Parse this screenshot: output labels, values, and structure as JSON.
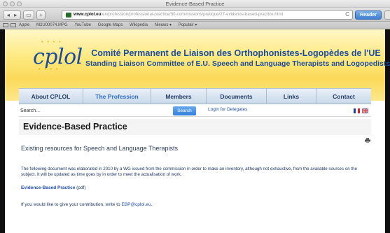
{
  "browser": {
    "window_title": "Evidence-Based Practice",
    "url_host": "www.cplol.eu",
    "url_path": "/en/profession/professional-practice/30-commissions/pratique/27-evidence-based-practice.html",
    "reader_label": "Reader",
    "reload_glyph": "C",
    "bookmarks": [
      "Apple",
      "M2U00074.MPG",
      "YouTube",
      "Google Maps",
      "Wikipedia",
      "Nieuws ▾",
      "Populair ▾"
    ]
  },
  "header": {
    "logo_text": "cplol",
    "org_name_fr": "Comité Permanent de Liaison des Orthophonistes-Logopèdes de l'UE",
    "org_name_en": "Standing Liaison Committee of E.U. Speech and Language Therapists and Logopedists"
  },
  "nav": {
    "items": [
      {
        "label": "About CPLOL"
      },
      {
        "label": "The Profession"
      },
      {
        "label": "Members"
      },
      {
        "label": "Documents"
      },
      {
        "label": "Links"
      },
      {
        "label": "Contact"
      }
    ]
  },
  "search": {
    "placeholder": "Search...",
    "button_label": "Search",
    "login_label": "Login for Delegates"
  },
  "article": {
    "title": "Evidence-Based Practice",
    "subtitle": "Existing resources for Speech and Language Therapists",
    "paragraph": "The following document was elaborated in 2010 by a WG issued from the commission in order to make an inventory, although not exhaustive, from the available sources on the subject. It will be updated as time goes by in order to meet the actualisation of work.",
    "doc_link": "Evidence-Based Practice",
    "doc_suffix": " (pdf)",
    "contact_prefix": "If you would like to give your contribution, write to ",
    "contact_email": "EBP@cplol.eu",
    "contact_suffix": "."
  },
  "colors": {
    "brand_blue": "#1d4c9b",
    "header_yellow": "#fbd95a",
    "link_blue": "#1a4eb0"
  }
}
